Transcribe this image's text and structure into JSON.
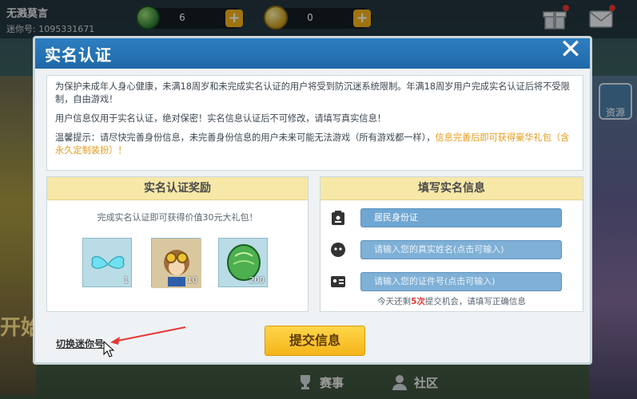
{
  "topbar": {
    "user_name": "无溅莫言",
    "user_id": "迷你号: 1095331671",
    "gems": "6",
    "coins": "0"
  },
  "background": {
    "left_text": "开始",
    "resource_label": "资源"
  },
  "bottom": {
    "match_label": "赛事",
    "community_label": "社区"
  },
  "modal": {
    "title": "实名认证",
    "close_label": "✕",
    "notice": {
      "para1": "为保护未成年人身心健康，未满18周岁和未完成实名认证的用户将受到防沉迷系统限制。年满18周岁用户完成实名认证后将不受限制，自由游戏！",
      "para2": "用户信息仅用于实名认证，绝对保密！实名信息认证后不可修改，请填写真实信息！",
      "para3_normal": "温馨提示：请尽快完善身份信息，未完善身份信息的用户未来可能无法游戏（所有游戏都一样），",
      "para3_highlight": "信息完善后即可获得豪华礼包（含永久定制装扮）！"
    },
    "reward": {
      "header": "实名认证奖励",
      "desc": "完成实名认证即可获得价值30元大礼包！",
      "items": [
        {
          "icon": "wings-icon",
          "count": "1"
        },
        {
          "icon": "character-icon",
          "count": "10"
        },
        {
          "icon": "green-gem-icon",
          "count": "200"
        }
      ]
    },
    "info": {
      "header": "填写实名信息",
      "id_type": "居民身份证",
      "name_placeholder": "请输入您的真实姓名(点击可输入)",
      "id_placeholder": "请输入您的证件号(点击可输入)",
      "attempts_pre": "今天还剩",
      "attempts_count": "5次",
      "attempts_post": "提交机会，请填写正确信息"
    },
    "switch_label": "切换迷你号",
    "submit_label": "提交信息"
  },
  "colors": {
    "header_blue": "#2d7fc1",
    "panel_head_yellow": "#f7e8a8",
    "warn_orange": "#e59a1c",
    "submit_yellow": "#f5b51a",
    "field_blue": "#7fb0d6"
  }
}
